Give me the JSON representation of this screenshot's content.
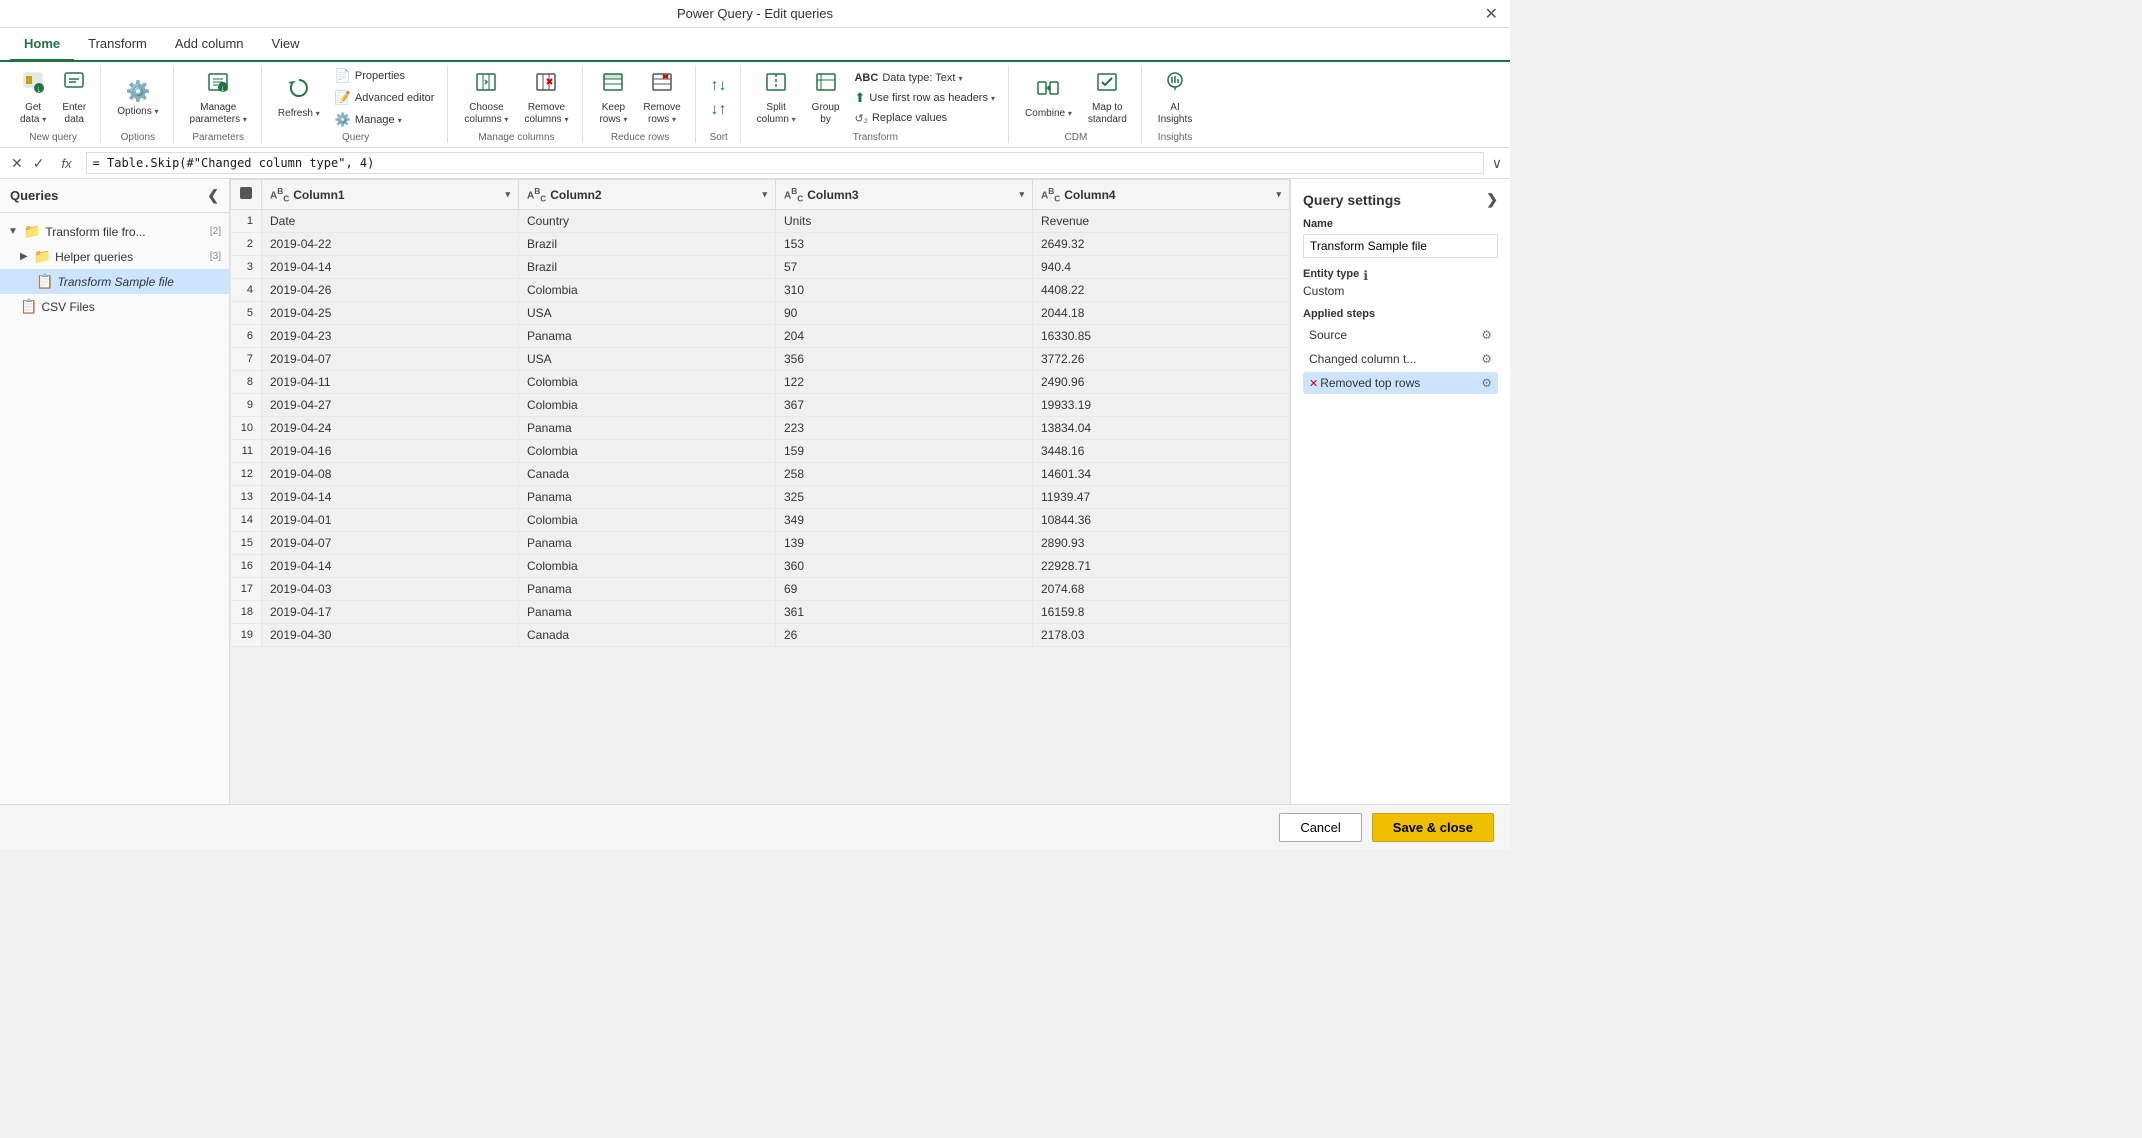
{
  "titleBar": {
    "title": "Power Query - Edit queries",
    "closeLabel": "✕"
  },
  "ribbonTabs": {
    "tabs": [
      "Home",
      "Transform",
      "Add column",
      "View"
    ],
    "activeTab": "Home"
  },
  "ribbon": {
    "groups": [
      {
        "label": "New query",
        "items": [
          {
            "id": "get-data",
            "label": "Get\ndata",
            "icon": "📥",
            "hasDropdown": true
          },
          {
            "id": "enter-data",
            "label": "Enter\ndata",
            "icon": "📋",
            "hasDropdown": false
          }
        ]
      },
      {
        "label": "Options",
        "items": [
          {
            "id": "options",
            "label": "Options",
            "icon": "⚙️",
            "hasDropdown": true
          }
        ]
      },
      {
        "label": "Parameters",
        "items": [
          {
            "id": "manage-params",
            "label": "Manage\nparameters",
            "icon": "📊",
            "hasDropdown": true
          }
        ]
      },
      {
        "label": "Query",
        "items": [
          {
            "id": "refresh",
            "label": "Refresh",
            "icon": "🔄",
            "hasDropdown": true
          },
          {
            "id": "properties-sm",
            "label": "Properties",
            "icon": "📄",
            "small": true
          },
          {
            "id": "advanced-editor-sm",
            "label": "Advanced editor",
            "icon": "📝",
            "small": true
          },
          {
            "id": "manage-sm",
            "label": "Manage ▾",
            "icon": "⚙️",
            "small": true
          }
        ]
      },
      {
        "label": "Manage columns",
        "items": [
          {
            "id": "choose-columns",
            "label": "Choose\ncolumns",
            "icon": "📑",
            "hasDropdown": true
          },
          {
            "id": "remove-columns",
            "label": "Remove\ncolumns",
            "icon": "❌",
            "hasDropdown": true
          }
        ]
      },
      {
        "label": "Reduce rows",
        "items": [
          {
            "id": "keep-rows",
            "label": "Keep\nrows",
            "icon": "⬇️",
            "hasDropdown": true
          },
          {
            "id": "remove-rows",
            "label": "Remove\nrows",
            "icon": "🗑️",
            "hasDropdown": true
          }
        ]
      },
      {
        "label": "Sort",
        "items": [
          {
            "id": "sort-asc",
            "label": "↑",
            "icon": "↑",
            "small": true
          },
          {
            "id": "sort-desc",
            "label": "↓",
            "icon": "↓",
            "small": true
          }
        ]
      },
      {
        "label": "Transform",
        "items": [
          {
            "id": "split-column",
            "label": "Split\ncolumn",
            "icon": "⬛",
            "hasDropdown": true
          },
          {
            "id": "group-by",
            "label": "Group\nby",
            "icon": "📊"
          },
          {
            "id": "data-type",
            "label": "Data type: Text ▾",
            "icon": "🔤",
            "small": true
          },
          {
            "id": "use-first-row",
            "label": "Use first row as headers ▾",
            "icon": "⬆️",
            "small": true
          },
          {
            "id": "replace-values",
            "label": "↺₂ Replace values",
            "icon": "",
            "small": true
          }
        ]
      },
      {
        "label": "CDM",
        "items": [
          {
            "id": "combine",
            "label": "Combine",
            "icon": "🔗",
            "hasDropdown": true
          },
          {
            "id": "map-to-standard",
            "label": "Map to\nstandard",
            "icon": "🗺️"
          }
        ]
      },
      {
        "label": "Insights",
        "items": [
          {
            "id": "ai-insights",
            "label": "AI\nInsights",
            "icon": "💡"
          }
        ]
      }
    ]
  },
  "formulaBar": {
    "cancelLabel": "✕",
    "confirmLabel": "✓",
    "fxLabel": "fx",
    "formula": "= Table.Skip(#\"Changed column type\", 4)",
    "expandLabel": "∨"
  },
  "sidebar": {
    "title": "Queries",
    "toggleIcon": "❮",
    "tree": [
      {
        "id": "transform-file-from",
        "label": "Transform file fro...",
        "count": "[2]",
        "icon": "📁",
        "indent": 0,
        "expanded": true,
        "isFolder": true
      },
      {
        "id": "helper-queries",
        "label": "Helper queries",
        "count": "[3]",
        "icon": "📁",
        "indent": 1,
        "expanded": false,
        "isFolder": true
      },
      {
        "id": "transform-sample-file",
        "label": "Transform Sample file",
        "count": "",
        "icon": "📋",
        "indent": 2,
        "selected": true,
        "isFolder": false
      },
      {
        "id": "csv-files",
        "label": "CSV Files",
        "count": "",
        "icon": "📋",
        "indent": 1,
        "selected": false,
        "isFolder": false
      }
    ]
  },
  "dataTable": {
    "columns": [
      {
        "id": "col1",
        "typeIcon": "ABC",
        "name": "Column1"
      },
      {
        "id": "col2",
        "typeIcon": "ABC",
        "name": "Column2"
      },
      {
        "id": "col3",
        "typeIcon": "ABC",
        "name": "Column3"
      },
      {
        "id": "col4",
        "typeIcon": "ABC",
        "name": "Column4"
      }
    ],
    "rows": [
      {
        "num": 1,
        "col1": "Date",
        "col2": "Country",
        "col3": "Units",
        "col4": "Revenue"
      },
      {
        "num": 2,
        "col1": "2019-04-22",
        "col2": "Brazil",
        "col3": "153",
        "col4": "2649.32"
      },
      {
        "num": 3,
        "col1": "2019-04-14",
        "col2": "Brazil",
        "col3": "57",
        "col4": "940.4"
      },
      {
        "num": 4,
        "col1": "2019-04-26",
        "col2": "Colombia",
        "col3": "310",
        "col4": "4408.22"
      },
      {
        "num": 5,
        "col1": "2019-04-25",
        "col2": "USA",
        "col3": "90",
        "col4": "2044.18"
      },
      {
        "num": 6,
        "col1": "2019-04-23",
        "col2": "Panama",
        "col3": "204",
        "col4": "16330.85"
      },
      {
        "num": 7,
        "col1": "2019-04-07",
        "col2": "USA",
        "col3": "356",
        "col4": "3772.26"
      },
      {
        "num": 8,
        "col1": "2019-04-11",
        "col2": "Colombia",
        "col3": "122",
        "col4": "2490.96"
      },
      {
        "num": 9,
        "col1": "2019-04-27",
        "col2": "Colombia",
        "col3": "367",
        "col4": "19933.19"
      },
      {
        "num": 10,
        "col1": "2019-04-24",
        "col2": "Panama",
        "col3": "223",
        "col4": "13834.04"
      },
      {
        "num": 11,
        "col1": "2019-04-16",
        "col2": "Colombia",
        "col3": "159",
        "col4": "3448.16"
      },
      {
        "num": 12,
        "col1": "2019-04-08",
        "col2": "Canada",
        "col3": "258",
        "col4": "14601.34"
      },
      {
        "num": 13,
        "col1": "2019-04-14",
        "col2": "Panama",
        "col3": "325",
        "col4": "11939.47"
      },
      {
        "num": 14,
        "col1": "2019-04-01",
        "col2": "Colombia",
        "col3": "349",
        "col4": "10844.36"
      },
      {
        "num": 15,
        "col1": "2019-04-07",
        "col2": "Panama",
        "col3": "139",
        "col4": "2890.93"
      },
      {
        "num": 16,
        "col1": "2019-04-14",
        "col2": "Colombia",
        "col3": "360",
        "col4": "22928.71"
      },
      {
        "num": 17,
        "col1": "2019-04-03",
        "col2": "Panama",
        "col3": "69",
        "col4": "2074.68"
      },
      {
        "num": 18,
        "col1": "2019-04-17",
        "col2": "Panama",
        "col3": "361",
        "col4": "16159.8"
      },
      {
        "num": 19,
        "col1": "2019-04-30",
        "col2": "Canada",
        "col3": "26",
        "col4": "2178.03"
      }
    ]
  },
  "querySettings": {
    "title": "Query settings",
    "expandIcon": "❯",
    "nameLabel": "Name",
    "nameValue": "Transform Sample file",
    "entityTypeLabel": "Entity type",
    "entityTypeValue": "Custom",
    "appliedStepsLabel": "Applied steps",
    "steps": [
      {
        "id": "source",
        "label": "Source",
        "active": false,
        "hasX": false
      },
      {
        "id": "changed-col-type",
        "label": "Changed column t...",
        "active": false,
        "hasX": false
      },
      {
        "id": "removed-top-rows",
        "label": "Removed top rows",
        "active": true,
        "hasX": true
      }
    ]
  },
  "bottomBar": {
    "cancelLabel": "Cancel",
    "saveLabel": "Save & close"
  }
}
